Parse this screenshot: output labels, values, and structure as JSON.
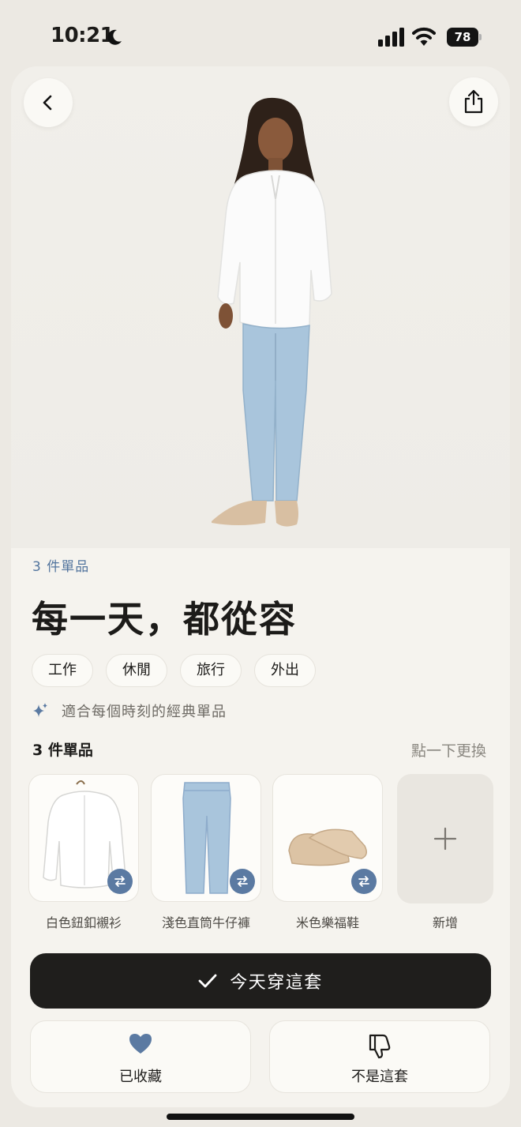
{
  "status_bar": {
    "time": "10:21",
    "battery": "78"
  },
  "outfit": {
    "count_label": "3 件單品",
    "title": "每一天，都從容",
    "tags": [
      "工作",
      "休閒",
      "旅行",
      "外出"
    ],
    "note": "適合每個時刻的經典單品"
  },
  "items_section": {
    "header": "3 件單品",
    "hint": "點一下更換",
    "items": [
      {
        "name": "白色鈕釦襯衫"
      },
      {
        "name": "淺色直筒牛仔褲"
      },
      {
        "name": "米色樂福鞋"
      }
    ],
    "add_label": "新增"
  },
  "actions": {
    "wear_today": "今天穿這套",
    "saved": "已收藏",
    "not_this": "不是這套"
  },
  "colors": {
    "accent": "#5b7aa2",
    "primary_button": "#1f1e1c",
    "background": "#f5f3ee"
  }
}
